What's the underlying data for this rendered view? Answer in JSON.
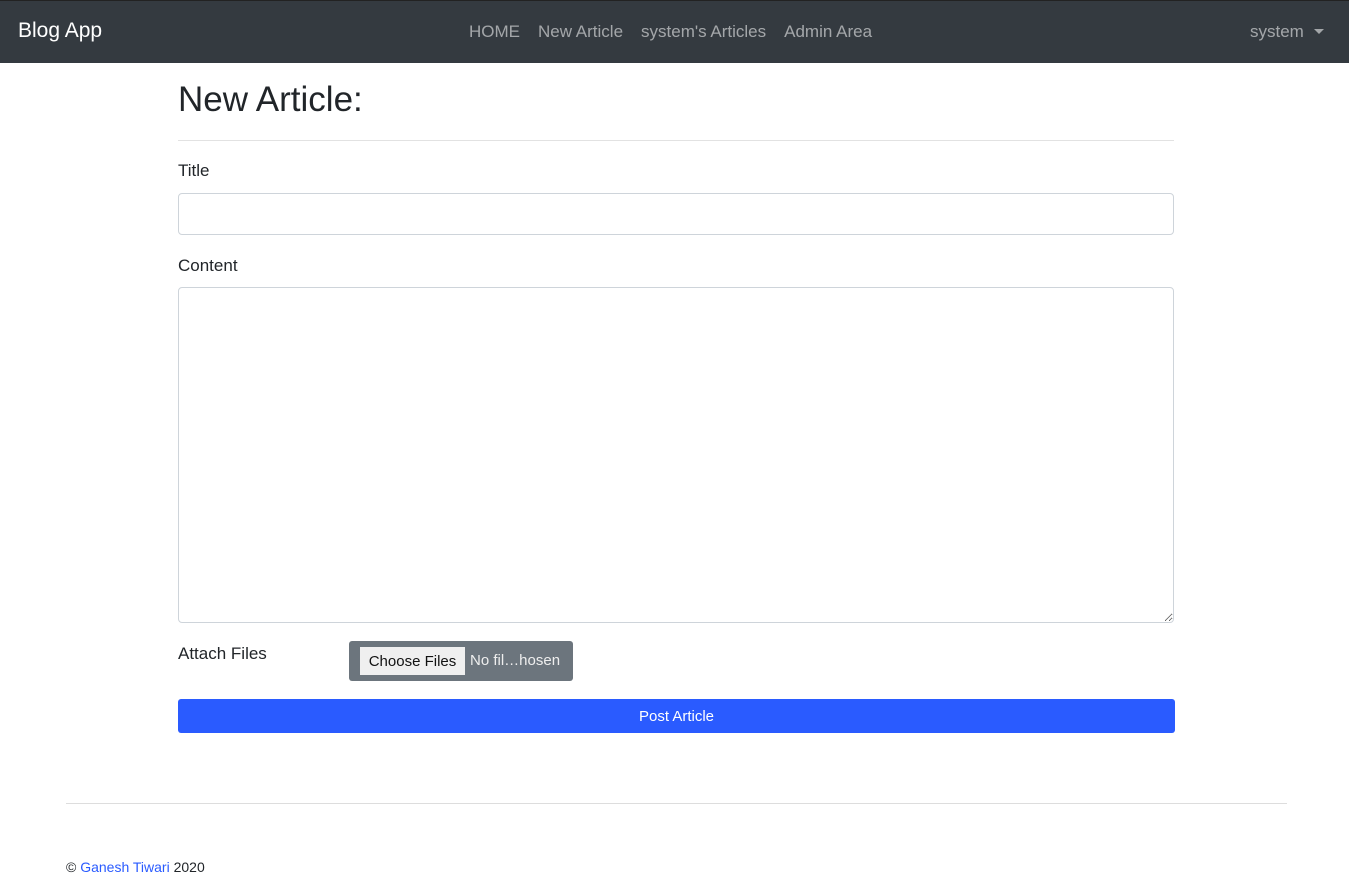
{
  "nav": {
    "brand": "Blog App",
    "links": [
      "HOME",
      "New Article",
      "system's Articles",
      "Admin Area"
    ],
    "user": "system"
  },
  "page": {
    "title": "New Article:",
    "title_label": "Title",
    "title_value": "",
    "content_label": "Content",
    "content_value": "",
    "attach_label": "Attach Files",
    "choose_label": "Choose Files",
    "file_status": "No fil…hosen",
    "post_label": "Post Article"
  },
  "footer": {
    "copy": "©",
    "author": "Ganesh Tiwari",
    "year": "2020"
  }
}
